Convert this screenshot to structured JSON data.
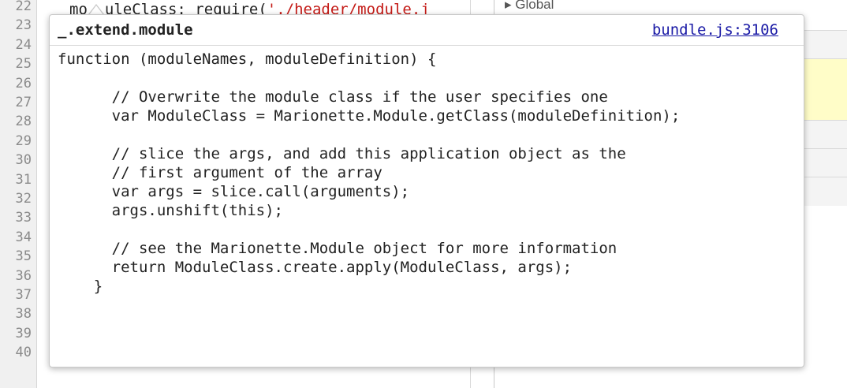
{
  "editor": {
    "line_numbers": [
      "22",
      "23",
      "24",
      "25",
      "26",
      "27",
      "28",
      "29",
      "30",
      "31",
      "32",
      "33",
      "34",
      "35",
      "36",
      "37",
      "38",
      "39",
      "40"
    ],
    "top_line_prefix": "mo",
    "top_line_mid": "uleClass: require(",
    "top_line_string": "'./header/module.j"
  },
  "right_panel": {
    "partial_title": "▸ Global"
  },
  "popover": {
    "title": "_.extend.module",
    "source_link": "bundle.js:3106",
    "code_lines": [
      "function (moduleNames, moduleDefinition) {",
      "",
      "      // Overwrite the module class if the user specifies one",
      "      var ModuleClass = Marionette.Module.getClass(moduleDefinition);",
      "",
      "      // slice the args, and add this application object as the",
      "      // first argument of the array",
      "      var args = slice.call(arguments);",
      "      args.unshift(this);",
      "",
      "      // see the Marionette.Module object for more information",
      "      return ModuleClass.create.apply(ModuleClass, args);",
      "    }"
    ]
  }
}
